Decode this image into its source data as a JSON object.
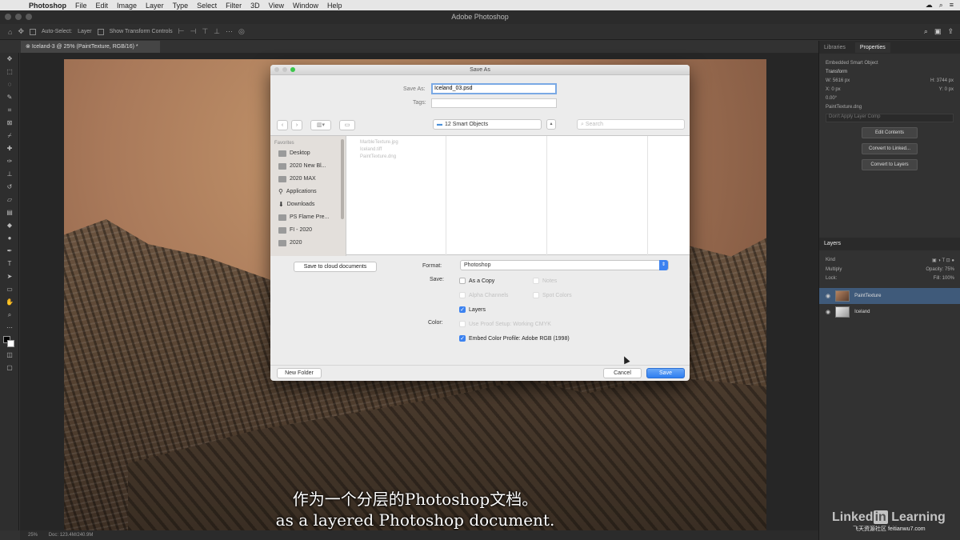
{
  "menubar": {
    "app": "Photoshop",
    "items": [
      "File",
      "Edit",
      "Image",
      "Layer",
      "Type",
      "Select",
      "Filter",
      "3D",
      "View",
      "Window",
      "Help"
    ]
  },
  "window": {
    "title": "Adobe Photoshop"
  },
  "options_bar": {
    "auto_select": "Auto-Select:",
    "auto_select_value": "Layer",
    "show_transform": "Show Transform Controls"
  },
  "document_tab": "Iceland-3 @ 25% (PaintTexture, RGB/16) *",
  "status_bar": {
    "zoom": "25%",
    "doc": "Doc: 123.4M/240.9M"
  },
  "subtitles": {
    "zh": "作为一个分层的Photoshop文档。",
    "en": "as a layered Photoshop document."
  },
  "branding": {
    "linkedin_a": "Linked",
    "linkedin_in": "in",
    "linkedin_b": " Learning",
    "watermark": "飞天资源社区 feitianwu7.com"
  },
  "right_panel": {
    "tabs": [
      "Libraries",
      "Properties"
    ],
    "smart_object": "Embedded Smart Object",
    "transform_label": "Transform",
    "w": "W: 5616 px",
    "h": "H: 3744 px",
    "x": "X: 0 px",
    "y": "Y: 0 px",
    "angle": "0.00°",
    "filename": "PaintTexture.dng",
    "layer_comp": "Don't Apply Layer Comp",
    "buttons": [
      "Edit Contents",
      "Convert to Linked...",
      "Convert to Layers"
    ]
  },
  "layers_panel": {
    "title": "Layers",
    "kind": "Kind",
    "blend": "Multiply",
    "opacity": "Opacity: 75%",
    "lock": "Lock:",
    "fill": "Fill: 100%",
    "layers": [
      "PaintTexture",
      "Iceland"
    ]
  },
  "dialog": {
    "title": "Save As",
    "save_as_label": "Save As:",
    "save_as_value": "Iceland_03.psd",
    "tags_label": "Tags:",
    "location": "12 Smart Objects",
    "search_placeholder": "Search",
    "favorites_label": "Favorites",
    "favorites": [
      "Desktop",
      "2020 New Bl...",
      "2020 MAX",
      "Applications",
      "Downloads",
      "PS Flame Pre...",
      "FI - 2020",
      "2020"
    ],
    "files": [
      "MarbleTexture.jpg",
      "Iceland.tiff",
      "PaintTexture.dng"
    ],
    "cloud_button": "Save to cloud documents",
    "format_label": "Format:",
    "format_value": "Photoshop",
    "save_label": "Save:",
    "as_copy": "As a Copy",
    "notes": "Notes",
    "alpha": "Alpha Channels",
    "spot": "Spot Colors",
    "layers": "Layers",
    "color_label": "Color:",
    "proof": "Use Proof Setup: Working CMYK",
    "embed": "Embed Color Profile:  Adobe RGB (1998)",
    "new_folder": "New Folder",
    "cancel": "Cancel",
    "save": "Save"
  }
}
